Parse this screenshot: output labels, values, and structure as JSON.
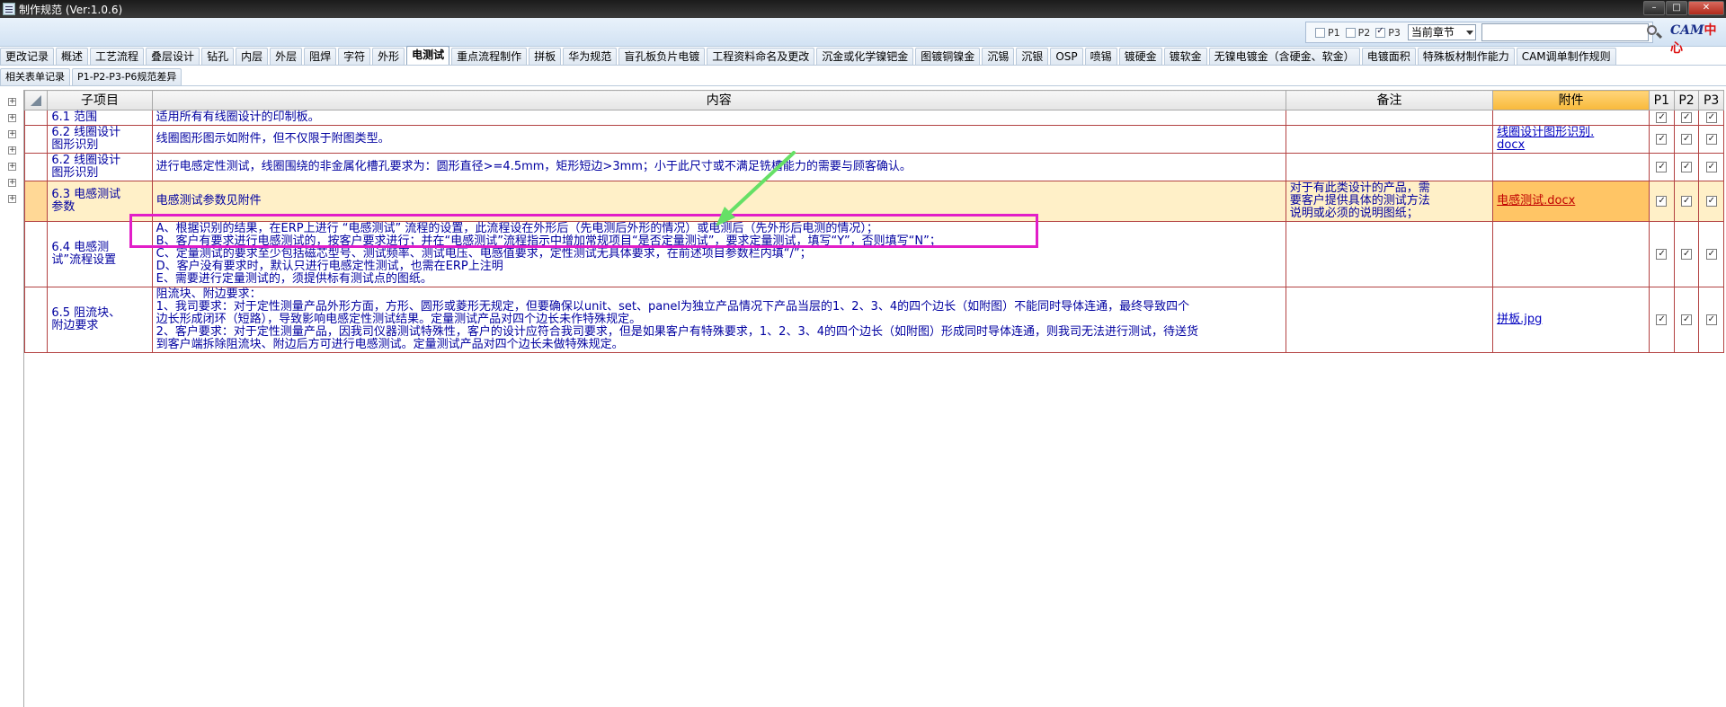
{
  "window": {
    "title": "制作规范 (Ver:1.0.6)",
    "controls": [
      "–",
      "□",
      "✕"
    ]
  },
  "toolbar": {
    "filters": [
      {
        "label": "P1",
        "checked": false
      },
      {
        "label": "P2",
        "checked": false
      },
      {
        "label": "P3",
        "checked": true
      }
    ],
    "scope_select": "当前章节",
    "search_value": "",
    "logo_text": "CAM",
    "logo_red": "中心"
  },
  "tabs_row1": [
    "更改记录",
    "概述",
    "工艺流程",
    "叠层设计",
    "钻孔",
    "内层",
    "外层",
    "阻焊",
    "字符",
    "外形",
    "电测试",
    "重点流程制作",
    "拼板",
    "华为规范",
    "盲孔板负片电镀",
    "工程资料命名及更改",
    "沉金或化学镍钯金",
    "图镀铜镍金",
    "沉锡",
    "沉银",
    "OSP",
    "喷锡",
    "镀硬金",
    "镀软金",
    "无镍电镀金（含硬金、软金）",
    "电镀面积",
    "特殊板材制作能力",
    "CAM调单制作规则"
  ],
  "active_tab": "电测试",
  "tabs_row2": [
    "相关表单记录",
    "P1-P2-P3-P6规范差异"
  ],
  "grid": {
    "headers": {
      "sub": "子项目",
      "content": "内容",
      "remark": "备注",
      "attachment": "附件",
      "p1": "P1",
      "p2": "P2",
      "p3": "P3"
    },
    "rows": [
      {
        "sub": [
          "6.1 范围"
        ],
        "content": [
          "适用所有有线圈设计的印制板。"
        ],
        "remark": [],
        "attachment": "",
        "p": [
          true,
          true,
          true
        ]
      },
      {
        "sub": [
          "6.2 线圈设计",
          "图形识别"
        ],
        "content": [
          "线圈图形图示如附件，但不仅限于附图类型。"
        ],
        "remark": [],
        "attachment": "线圈设计图形识别.",
        "attachment2": "docx",
        "p": [
          true,
          true,
          true
        ]
      },
      {
        "sub": [
          "6.2 线圈设计",
          "图形识别"
        ],
        "content": [
          "进行电感定性测试，线圈围绕的非金属化槽孔要求为：圆形直径>=4.5mm，矩形短边>3mm；小于此尺寸或不满足铣槽能力的需要与顾客确认。"
        ],
        "remark": [],
        "attachment": "",
        "p": [
          true,
          true,
          true
        ]
      },
      {
        "sub": [
          "6.3 电感测试",
          "参数"
        ],
        "content": [
          "电感测试参数见附件"
        ],
        "remark": [
          "对于有此类设计的产品，需",
          "要客户提供具体的测试方法",
          "说明或必须的说明图纸；"
        ],
        "attachment": "电感测试.docx",
        "p": [
          true,
          true,
          true
        ]
      },
      {
        "sub": [
          "6.4 电感测",
          "试”流程设置"
        ],
        "content": [
          "A、根据识别的结果，在ERP上进行 “电感测试” 流程的设置，此流程设在外形后（先电测后外形的情况）或电测后（先外形后电测的情况）；",
          "B、客户有要求进行电感测试的，按客户要求进行；并在“电感测试”流程指示中增加常规项目“是否定量测试”，要求定量测试，填写“Y”，否则填写“N”；",
          "C、定量测试的要求至少包括磁芯型号、测试频率、测试电压、电感值要求，定性测试无具体要求，在前述项目参数栏内填“/”；",
          "D、客户没有要求时，默认只进行电感定性测试，也需在ERP上注明",
          "E、需要进行定量测试的，须提供标有测试点的图纸。"
        ],
        "remark": [],
        "attachment": "",
        "p": [
          true,
          true,
          true
        ]
      },
      {
        "sub": [
          "6.5 阻流块、",
          "附边要求"
        ],
        "content": [
          "阻流块、附边要求：",
          "1、我司要求：对于定性测量产品外形方面，方形、圆形或菱形无规定，但要确保以unit、set、panel为独立产品情况下产品当层的1、2、3、4的四个边长（如附图）不能同时导体连通，最终导致四个",
          "边长形成闭环（短路），导致影响电感定性测试结果。定量测试产品对四个边长未作特殊规定。",
          "2、客户要求：对于定性测量产品，因我司仪器测试特殊性，客户的设计应符合我司要求，但是如果客户有特殊要求，1、2、3、4的四个边长（如附图）形成同时导体连通，则我司无法进行测试，待送货",
          "到客户端拆除阻流块、附边后方可进行电感测试。定量测试产品对四个边长未做特殊规定。"
        ],
        "remark": [],
        "attachment": "拼板.jpg",
        "p": [
          true,
          true,
          true
        ]
      }
    ]
  },
  "colors": {
    "annotation_box": "#e21ec8",
    "annotation_arrow": "#66e066",
    "attachment_header": "#f8b93a",
    "row_border": "#b34242"
  }
}
